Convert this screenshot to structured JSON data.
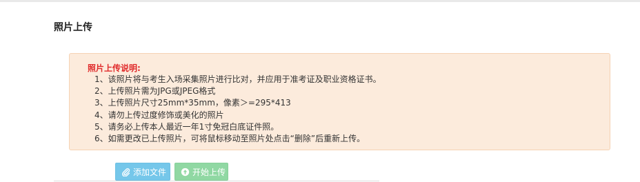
{
  "page": {
    "title": "照片上传"
  },
  "notice": {
    "title": "照片上传说明:",
    "items": [
      "1、该照片将与考生入场采集照片进行比对，并应用于准考证及职业资格证书。",
      "2、上传照片需为JPG或JPEG格式",
      "3、上传照片尺寸25mm*35mm，像素＞=295*413",
      "4、请勿上传过度修饰或美化的照片",
      "5、请务必上传本人最近一年1寸免冠白底证件照。",
      "6、如需更改已上传照片，可将鼠标移动至照片处点击“删除”后重新上传。"
    ],
    "title_color": "#e02a2a",
    "background_color": "#fcebdc"
  },
  "toolbar": {
    "add_label": "添加文件",
    "add_icon": "paperclip-icon",
    "start_label": "开始上传",
    "start_icon": "upload-circle-icon"
  }
}
